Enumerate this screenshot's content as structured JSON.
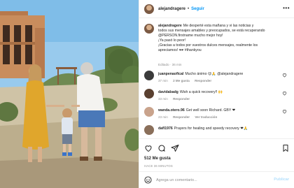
{
  "post": {
    "username": "alejandragere",
    "follow_label": "Seguir",
    "more_label": "•••"
  },
  "caption": {
    "username": "alejandragere",
    "line1": "Me desperté esta mañana y vi las noticias y",
    "line2": "todos sus mensajes amables y preocupados, se está recuperando",
    "line3": "@PERSON.firstname mucho mejor hoy!",
    "line4": "¡Ya pasó lo peor!",
    "line5": "¡Gracias a todos por vuestros dulces mensajes, realmente los",
    "line6": "apreciamos! 🕶 #thankyou",
    "meta": "Editado · 36 min"
  },
  "comments": [
    {
      "username": "juanpenaofical",
      "text": "Mucho ánimo 😍🙏 @alejandragere",
      "time": "37 min",
      "likes": "2 Me gusta",
      "reply": "Responder",
      "avatar_color": "#3b3b3b",
      "heart_color": "#262626"
    },
    {
      "username": "davidabadg",
      "text": "Wish a quick recovery!! 🙌",
      "time": "33 min",
      "likes": "",
      "reply": "Responder",
      "avatar_color": "#5a4030",
      "heart_color": "#262626"
    },
    {
      "username": "wanda.otero.96",
      "text": "Get well soon Richard. GBY ❤",
      "time": "23 min",
      "likes": "",
      "reply": "Responder",
      "extra": "Ver traducción",
      "avatar_color": "#c9a38c",
      "heart_color": "#262626"
    },
    {
      "username": "dafl1976",
      "text": "Prayers for healing and speedy recovery ❤🙏",
      "time": "",
      "likes": "",
      "reply": "",
      "avatar_color": "#8a6f5a",
      "heart_color": "#262626"
    }
  ],
  "stats": {
    "likes": "512 Me gusta",
    "ago": "HACE 36 MINUTOS"
  },
  "comment_box": {
    "placeholder": "Agrega un comentario...",
    "publish_label": "Publicar"
  },
  "colors": {
    "accent": "#0095f6",
    "mention": "#00376b",
    "muted": "#8e8e8e"
  },
  "icons": [
    "heart-icon",
    "comment-icon",
    "share-icon",
    "save-icon",
    "emoji-icon",
    "more-icon"
  ]
}
